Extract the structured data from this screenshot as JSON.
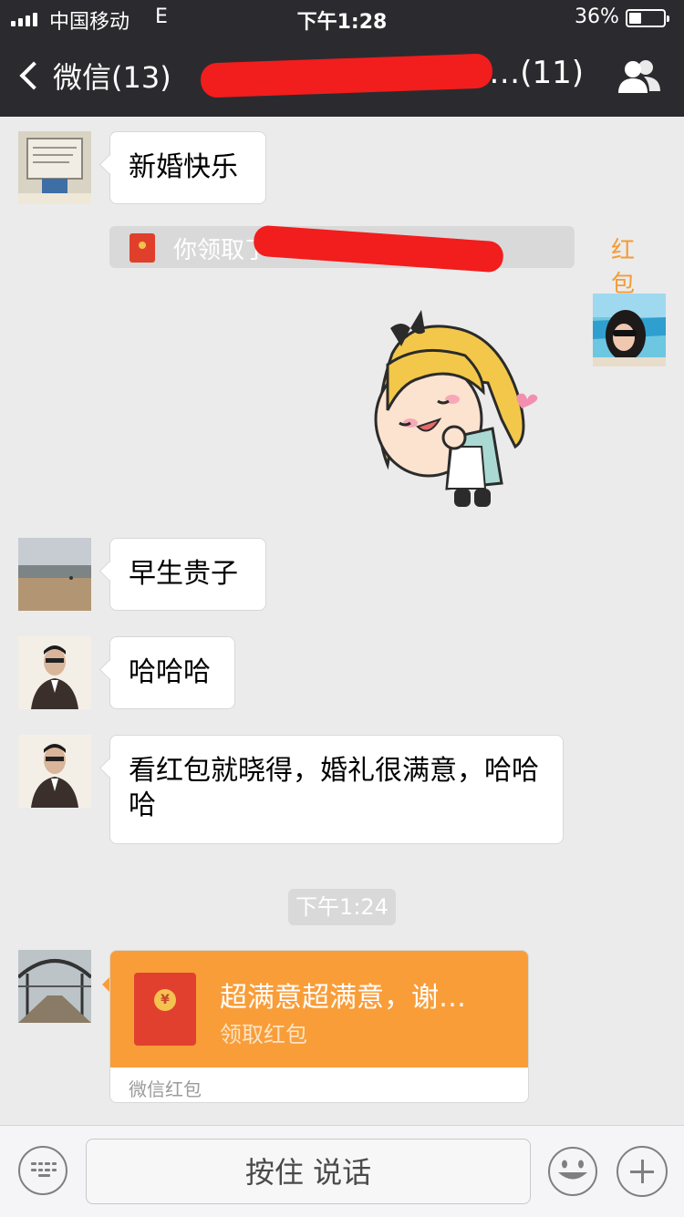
{
  "status_bar": {
    "carrier": "中国移动",
    "network": "E",
    "time": "下午1:28",
    "battery_pct": "36%",
    "battery_level": 0.36
  },
  "nav": {
    "back_label": "微信(13)",
    "title": "…(11)",
    "right_icon": "group-members-icon"
  },
  "messages": [
    {
      "text": "新婚快乐"
    },
    {
      "text": "早生贵子"
    },
    {
      "text": "哈哈哈"
    },
    {
      "text": "看红包就晓得，婚礼很满意，哈哈哈"
    }
  ],
  "system": {
    "redpacket_notice_prefix": "你领取了",
    "redpacket_notice_link": "红包",
    "timestamp": "下午1:24"
  },
  "hongbao": {
    "title": "超满意超满意，谢…",
    "subtitle": "领取红包",
    "footer": "微信红包",
    "coin_symbol": "¥"
  },
  "input_bar": {
    "hold_to_talk": "按住 说话",
    "left_icon": "keyboard-icon",
    "emoji_icon": "emoji-icon",
    "plus_icon": "plus-icon"
  },
  "colors": {
    "nav_bg": "#2b2b2f",
    "chat_bg": "#ebebeb",
    "hongbao_orange": "#f99d39",
    "link_orange": "#f39c37",
    "redaction_red": "#f21d1d"
  }
}
